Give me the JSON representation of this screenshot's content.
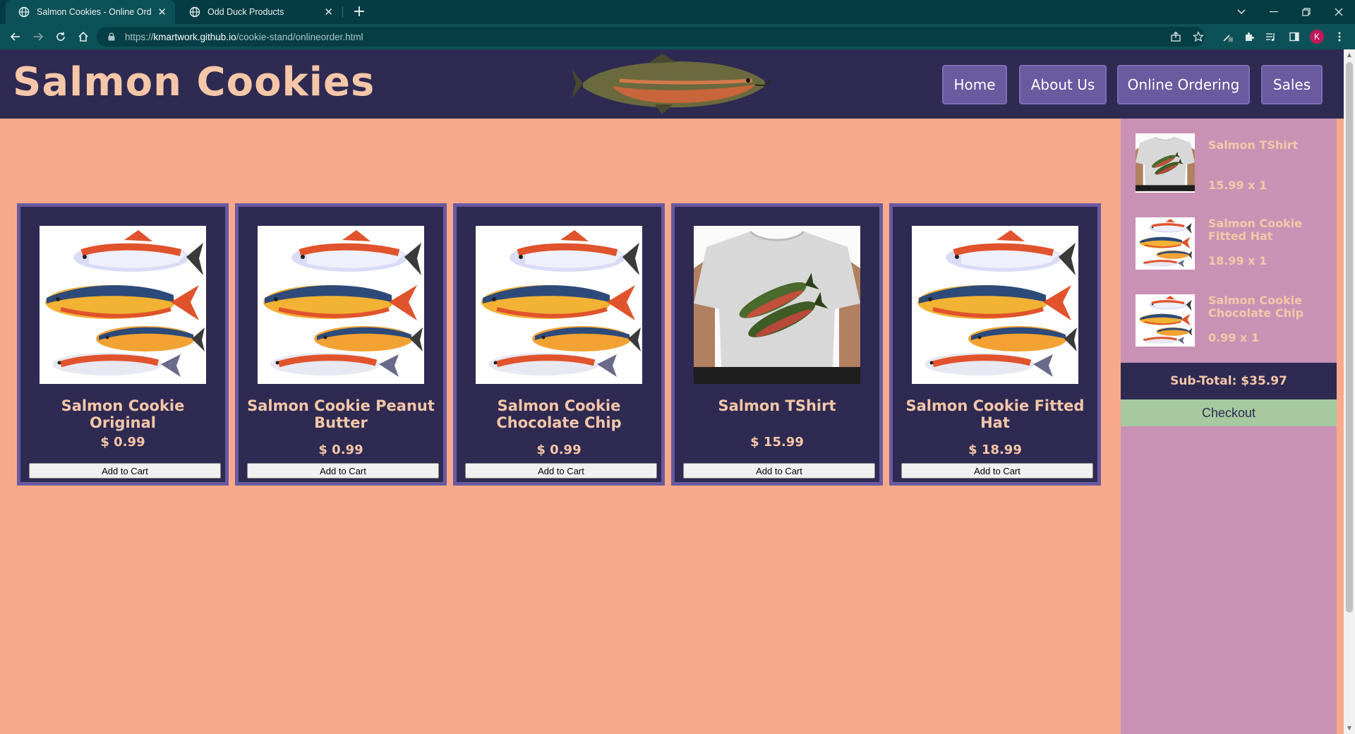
{
  "browser": {
    "tabs": [
      {
        "title": "Salmon Cookies - Online Ordering",
        "active": true
      },
      {
        "title": "Odd Duck Products",
        "active": false
      }
    ],
    "url": {
      "scheme": "https://",
      "host": "kmartwork.github.io",
      "path": "/cookie-stand/onlineorder.html"
    },
    "profile_initial": "K"
  },
  "site": {
    "title": "Salmon Cookies",
    "nav": [
      "Home",
      "About Us",
      "Online Ordering",
      "Sales"
    ]
  },
  "products": [
    {
      "name": "Salmon Cookie Original",
      "price": "$ 0.99",
      "button": "Add to Cart",
      "image": "fish-group"
    },
    {
      "name": "Salmon Cookie Peanut Butter",
      "price": "$ 0.99",
      "button": "Add to Cart",
      "image": "fish-group"
    },
    {
      "name": "Salmon Cookie Chocolate Chip",
      "price": "$ 0.99",
      "button": "Add to Cart",
      "image": "fish-group"
    },
    {
      "name": "Salmon TShirt",
      "price": "$ 15.99",
      "button": "Add to Cart",
      "image": "tshirt"
    },
    {
      "name": "Salmon Cookie Fitted Hat",
      "price": "$ 18.99",
      "button": "Add to Cart",
      "image": "fish-group"
    }
  ],
  "cart": {
    "items": [
      {
        "name": "Salmon TShirt",
        "qty": "15.99 x 1",
        "image": "tshirt"
      },
      {
        "name": "Salmon Cookie Fitted Hat",
        "qty": "18.99 x 1",
        "image": "fish-group"
      },
      {
        "name": "Salmon Cookie Chocolate Chip",
        "qty": "0.99 x 1",
        "image": "fish-group"
      }
    ],
    "subtotal": "Sub-Total: $35.97",
    "checkout": "Checkout"
  },
  "colors": {
    "page_bg": "#f9a98b",
    "header_bg": "#2e2a52",
    "nav_button": "#6a5aa0",
    "title_text": "#f5c7a8",
    "cart_bg": "#c992b4",
    "checkout_bg": "#a6c9a0"
  }
}
